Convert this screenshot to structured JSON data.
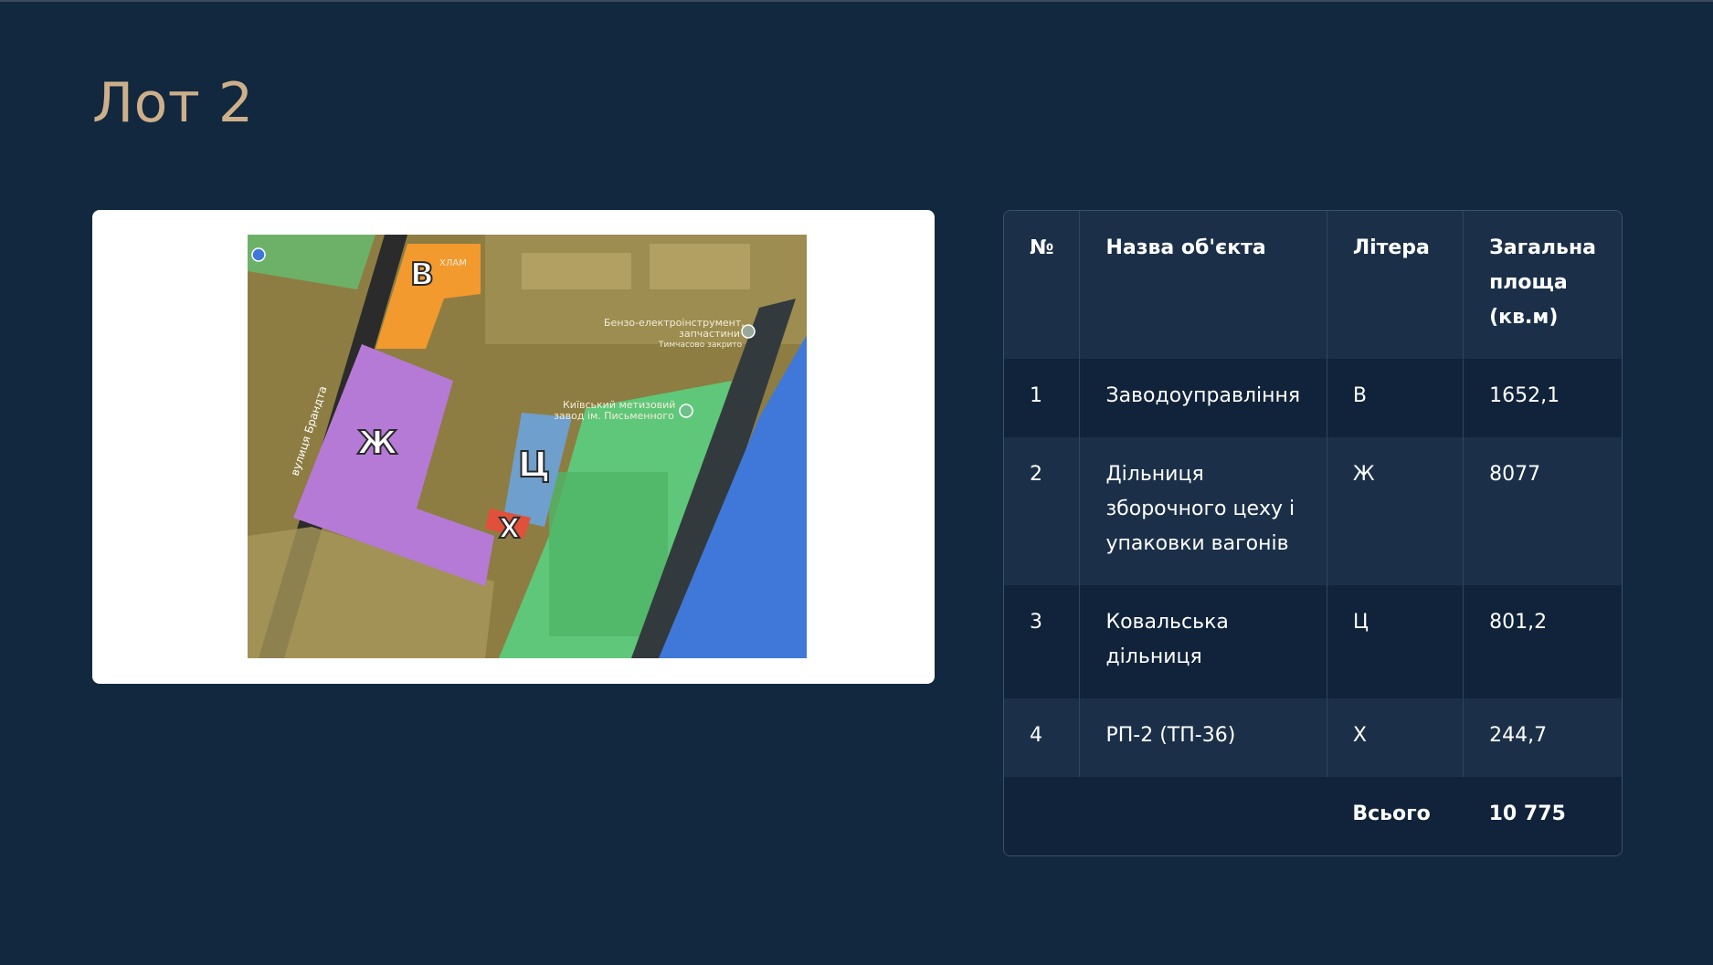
{
  "slide": {
    "title": "Лот 2"
  },
  "map": {
    "labels": {
      "v": "В",
      "zh": "Ж",
      "ts": "Ц",
      "kh": "Х",
      "street": "вулиця Брандта",
      "poi1_line1": "Бензо-електроінструмент,",
      "poi1_line2": "запчастини",
      "poi1_line3": "Тимчасово закрито",
      "poi2_line1": "Київський метизовий",
      "poi2_line2": "завод ім. Письменного",
      "poi3": "ХЛАМ"
    },
    "colors": {
      "building_v": "#f29a2e",
      "building_zh": "#b57ad6",
      "building_ts": "#6f9fcc",
      "building_kh": "#e0503a",
      "green_zone": "#5fc77a",
      "blue_zone": "#3f78d8",
      "yellow_zone": "#9a8a45"
    }
  },
  "table": {
    "headers": [
      "№",
      "Назва об'єкта",
      "Літера",
      "Загальна площа (кв.м)"
    ],
    "rows": [
      [
        "1",
        "Заводоуправління",
        "В",
        "1652,1"
      ],
      [
        "2",
        "Дільниця зборочного цеху і упаковки вагонів",
        "Ж",
        "8077"
      ],
      [
        "3",
        "Ковальська дільниця",
        "Ц",
        "801,2"
      ],
      [
        "4",
        "РП-2 (ТП-36)",
        "Х",
        "244,7"
      ]
    ],
    "total_label": "Всього",
    "total_value": "10 775"
  }
}
